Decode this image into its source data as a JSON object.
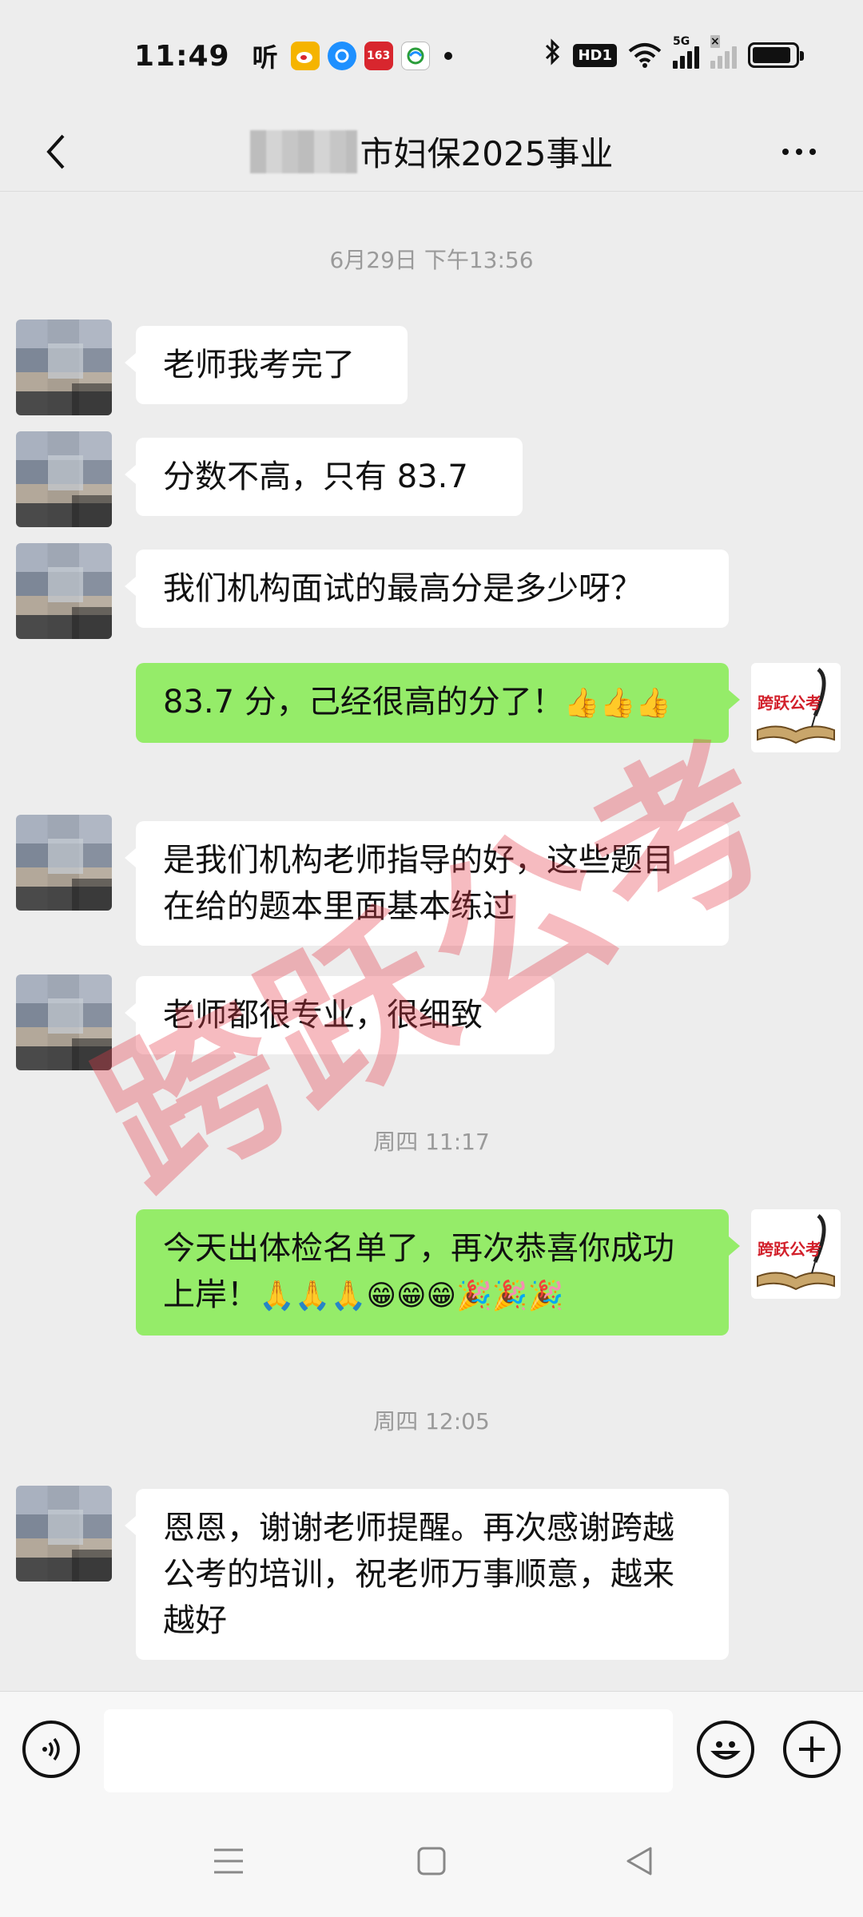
{
  "status_bar": {
    "time": "11:49",
    "ting_label": "听",
    "netease_label": "163",
    "hd_label": "HD1",
    "signal_5g_label": "5G",
    "signal_x_label": "×",
    "battery_percent": 90
  },
  "header": {
    "title": "市妇保2025事业"
  },
  "chat": {
    "timestamps": [
      "6月29日 下午13:56",
      "周四 11:17",
      "周四 12:05"
    ],
    "messages": [
      {
        "from": "other",
        "text": "老师我考完了"
      },
      {
        "from": "other",
        "text": "分数不高，只有 83.7"
      },
      {
        "from": "other",
        "text": "我们机构面试的最高分是多少呀？"
      },
      {
        "from": "me",
        "text": "83.7 分，己经很高的分了！",
        "emoji": "👍👍👍"
      },
      {
        "from": "other",
        "text": "是我们机构老师指导的好，这些题目在给的题本里面基本练过"
      },
      {
        "from": "other",
        "text": "老师都很专业，很细致"
      },
      {
        "from": "me",
        "text": "今天出体检名单了，再次恭喜你成功上岸！",
        "emoji": "🙏🙏🙏😁😁😁🎉🎉🎉"
      },
      {
        "from": "other",
        "text": "恩恩，谢谢老师提醒。再次感谢跨越公考的培训，祝老师万事顺意，越来越好"
      }
    ],
    "my_avatar_label": "跨跃公考"
  },
  "watermark": "跨跃公考",
  "input_bar": {
    "placeholder": ""
  },
  "colors": {
    "background": "#ededed",
    "my_bubble": "#95ec69",
    "other_bubble": "#ffffff",
    "watermark": "#e63c4b"
  }
}
